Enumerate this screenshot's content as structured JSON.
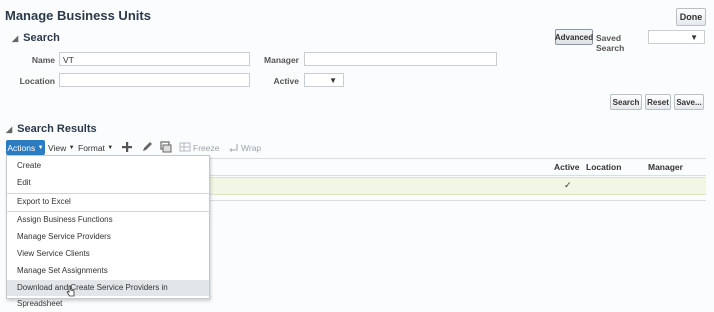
{
  "page": {
    "title": "Manage Business Units",
    "done_label": "Done"
  },
  "search": {
    "section_title": "Search",
    "advanced_label": "Advanced",
    "saved_search_label": "Saved Search",
    "fields": {
      "name_label": "Name",
      "name_value": "VT",
      "manager_label": "Manager",
      "manager_value": "",
      "location_label": "Location",
      "location_value": "",
      "active_label": "Active",
      "active_value": ""
    },
    "buttons": {
      "search": "Search",
      "reset": "Reset",
      "save": "Save..."
    }
  },
  "results": {
    "section_title": "Search Results",
    "toolbar": {
      "actions": "Actions",
      "view": "View",
      "format": "Format",
      "freeze": "Freeze",
      "wrap": "Wrap"
    },
    "columns": {
      "active": "Active",
      "location": "Location",
      "manager": "Manager"
    },
    "row": {
      "active_mark": "✓"
    }
  },
  "actions_menu": {
    "items": [
      "Create",
      "Edit",
      "Export to Excel",
      "Assign Business Functions",
      "Manage Service Providers",
      "View Service Clients",
      "Manage Set Assignments",
      "Download and Create Service Providers in Spreadsheet"
    ]
  },
  "colors": {
    "accent": "#2b7bc2",
    "row_highlight": "#f2f6e4",
    "title": "#2b3a4a"
  },
  "icons": [
    "add-icon",
    "edit-icon",
    "detach-icon",
    "freeze-icon",
    "wrap-icon",
    "mouse-pointer-icon"
  ]
}
